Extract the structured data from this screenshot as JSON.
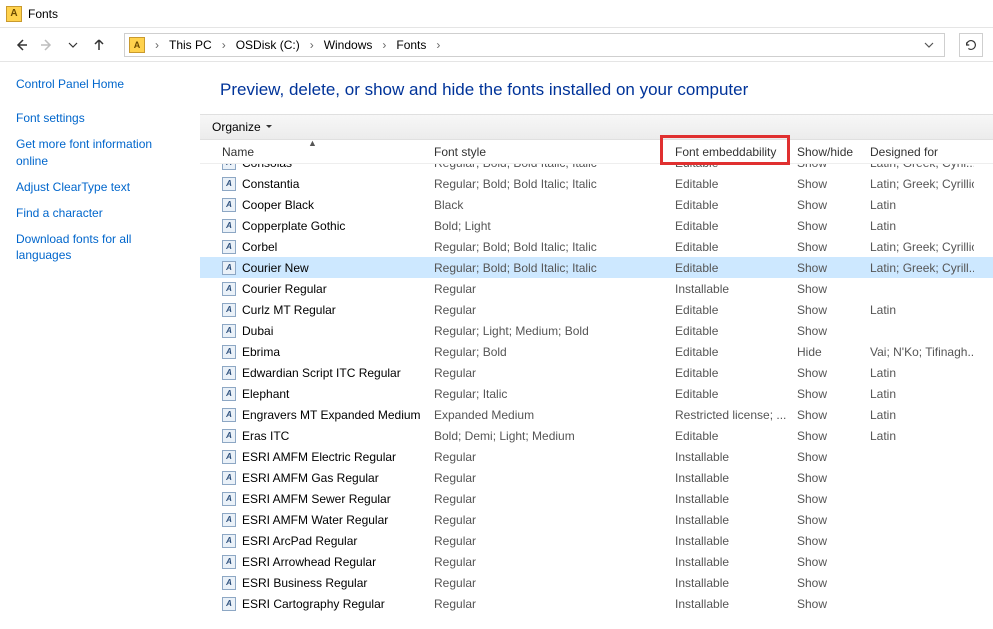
{
  "window": {
    "title": "Fonts"
  },
  "breadcrumbs": [
    "This PC",
    "OSDisk (C:)",
    "Windows",
    "Fonts"
  ],
  "sidebar": {
    "home": "Control Panel Home",
    "links": [
      "Font settings",
      "Get more font information online",
      "Adjust ClearType text",
      "Find a character",
      "Download fonts for all languages"
    ]
  },
  "heading": "Preview, delete, or show and hide the fonts installed on your computer",
  "toolbar": {
    "organize": "Organize"
  },
  "columns": {
    "name": "Name",
    "style": "Font style",
    "embed": "Font embeddability",
    "show": "Show/hide",
    "design": "Designed for"
  },
  "rows": [
    {
      "name": "Consolas",
      "style": "Regular; Bold; Bold Italic; Italic",
      "embed": "Editable",
      "show": "Show",
      "design": "Latin; Greek; Cyril...",
      "cut": true
    },
    {
      "name": "Constantia",
      "style": "Regular; Bold; Bold Italic; Italic",
      "embed": "Editable",
      "show": "Show",
      "design": "Latin; Greek; Cyrillic"
    },
    {
      "name": "Cooper Black",
      "style": "Black",
      "embed": "Editable",
      "show": "Show",
      "design": "Latin"
    },
    {
      "name": "Copperplate Gothic",
      "style": "Bold; Light",
      "embed": "Editable",
      "show": "Show",
      "design": "Latin"
    },
    {
      "name": "Corbel",
      "style": "Regular; Bold; Bold Italic; Italic",
      "embed": "Editable",
      "show": "Show",
      "design": "Latin; Greek; Cyrillic"
    },
    {
      "name": "Courier New",
      "style": "Regular; Bold; Bold Italic; Italic",
      "embed": "Editable",
      "show": "Show",
      "design": "Latin; Greek; Cyrill...",
      "selected": true
    },
    {
      "name": "Courier Regular",
      "style": "Regular",
      "embed": "Installable",
      "show": "Show",
      "design": ""
    },
    {
      "name": "Curlz MT Regular",
      "style": "Regular",
      "embed": "Editable",
      "show": "Show",
      "design": "Latin"
    },
    {
      "name": "Dubai",
      "style": "Regular; Light; Medium; Bold",
      "embed": "Editable",
      "show": "Show",
      "design": ""
    },
    {
      "name": "Ebrima",
      "style": "Regular; Bold",
      "embed": "Editable",
      "show": "Hide",
      "design": "Vai; N'Ko; Tifinagh..."
    },
    {
      "name": "Edwardian Script ITC Regular",
      "style": "Regular",
      "embed": "Editable",
      "show": "Show",
      "design": "Latin"
    },
    {
      "name": "Elephant",
      "style": "Regular; Italic",
      "embed": "Editable",
      "show": "Show",
      "design": "Latin"
    },
    {
      "name": "Engravers MT Expanded Medium",
      "style": "Expanded Medium",
      "embed": "Restricted license; ...",
      "show": "Show",
      "design": "Latin"
    },
    {
      "name": "Eras ITC",
      "style": "Bold; Demi; Light; Medium",
      "embed": "Editable",
      "show": "Show",
      "design": "Latin"
    },
    {
      "name": "ESRI AMFM Electric Regular",
      "style": "Regular",
      "embed": "Installable",
      "show": "Show",
      "design": ""
    },
    {
      "name": "ESRI AMFM Gas Regular",
      "style": "Regular",
      "embed": "Installable",
      "show": "Show",
      "design": ""
    },
    {
      "name": "ESRI AMFM Sewer Regular",
      "style": "Regular",
      "embed": "Installable",
      "show": "Show",
      "design": ""
    },
    {
      "name": "ESRI AMFM Water Regular",
      "style": "Regular",
      "embed": "Installable",
      "show": "Show",
      "design": ""
    },
    {
      "name": "ESRI ArcPad Regular",
      "style": "Regular",
      "embed": "Installable",
      "show": "Show",
      "design": ""
    },
    {
      "name": "ESRI Arrowhead Regular",
      "style": "Regular",
      "embed": "Installable",
      "show": "Show",
      "design": ""
    },
    {
      "name": "ESRI Business Regular",
      "style": "Regular",
      "embed": "Installable",
      "show": "Show",
      "design": ""
    },
    {
      "name": "ESRI Cartography Regular",
      "style": "Regular",
      "embed": "Installable",
      "show": "Show",
      "design": ""
    }
  ]
}
